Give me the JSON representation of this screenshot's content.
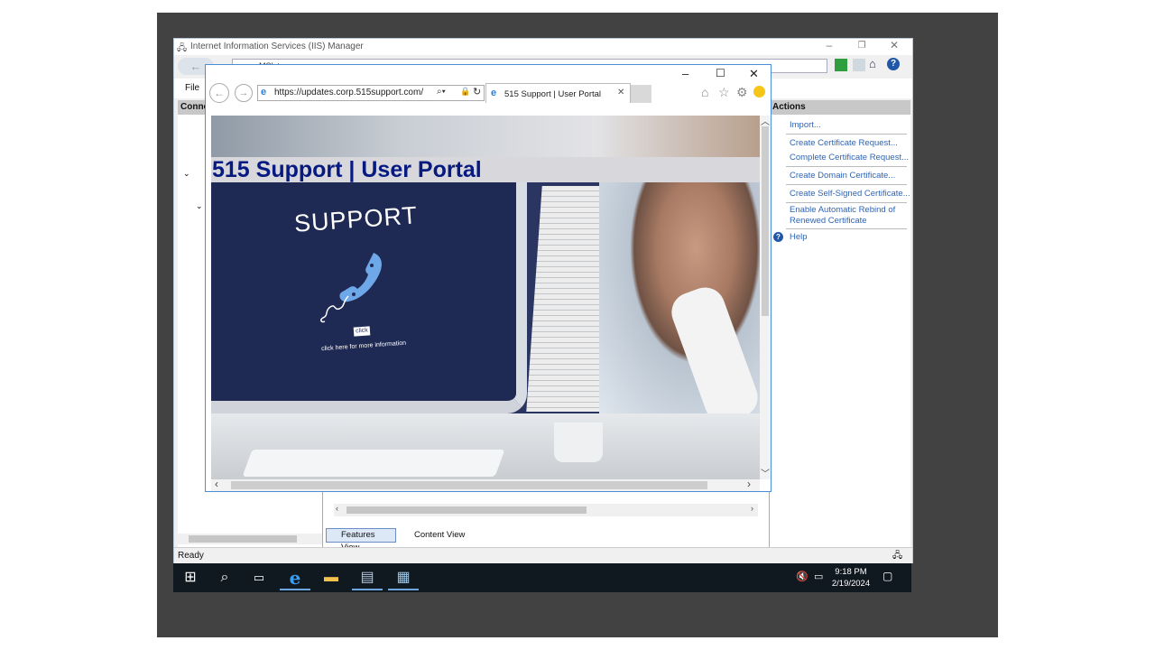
{
  "iis": {
    "title": "Internet Information Services (IIS) Manager",
    "address_fragment": "▸ MSIxt▸",
    "menu_file": "File",
    "connections_label": "Conne",
    "actions_label": "Actions",
    "actions": [
      "Import...",
      "Create Certificate Request...",
      "Complete Certificate Request...",
      "Create Domain Certificate...",
      "Create Self-Signed Certificate...",
      "Enable Automatic Rebind of Renewed Certificate",
      "Help"
    ],
    "features_view": "Features View",
    "content_view": "Content View",
    "status": "Ready"
  },
  "browser": {
    "url": "https://updates.corp.515support.com/",
    "tab_title": "515 Support | User Portal",
    "page": {
      "heading": "515 Support | User Portal",
      "hero_support": "SUPPORT",
      "hero_click": "click",
      "hero_caption": "click here for more information"
    }
  },
  "taskbar": {
    "time": "9:18 PM",
    "date": "2/19/2024"
  },
  "icons": [
    "windows-start-icon",
    "search-icon",
    "task-view-icon",
    "ie-icon",
    "file-explorer-icon",
    "server-manager-icon",
    "iis-manager-icon",
    "volume-muted-icon",
    "network-icon",
    "notification-icon",
    "back-icon",
    "forward-icon",
    "refresh-icon",
    "lock-icon",
    "home-icon",
    "star-icon",
    "gear-icon",
    "smiley-icon",
    "help-icon"
  ],
  "colors": {
    "banner_text": "#061a80",
    "link": "#2f64b4",
    "browser_border": "#4a8fd6",
    "taskbar": "#101820"
  }
}
